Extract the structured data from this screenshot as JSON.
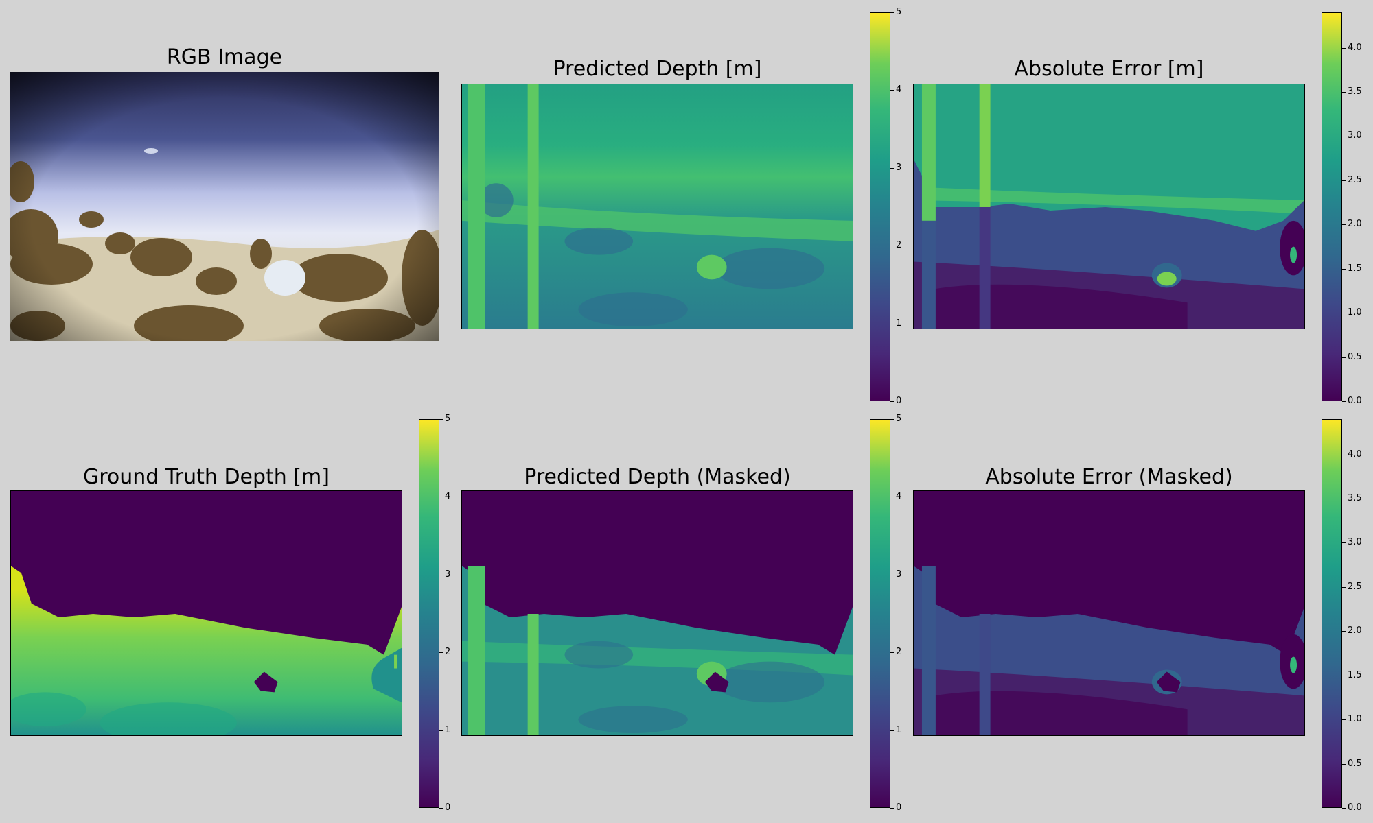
{
  "titles": {
    "rgb": "RGB Image",
    "pred": "Predicted Depth [m]",
    "err": "Absolute Error [m]",
    "gt": "Ground Truth Depth [m]",
    "pred_masked": "Predicted Depth (Masked)",
    "err_masked": "Absolute Error (Masked)"
  },
  "colormap": "viridis",
  "chart_data": [
    {
      "type": "heatmap",
      "title": "RGB Image",
      "content": "underwater photograph of rocks on sandy seabed"
    },
    {
      "type": "heatmap",
      "title": "Predicted Depth [m]",
      "colorbar": {
        "min": 0,
        "max": 5,
        "ticks": [
          "0",
          "1",
          "2",
          "3",
          "4",
          "5"
        ]
      }
    },
    {
      "type": "heatmap",
      "title": "Absolute Error [m]",
      "colorbar": {
        "min": 0,
        "max": 4.4,
        "ticks": [
          "0.0",
          "0.5",
          "1.0",
          "1.5",
          "2.0",
          "2.5",
          "3.0",
          "3.5",
          "4.0"
        ]
      }
    },
    {
      "type": "heatmap",
      "title": "Ground Truth Depth [m]",
      "colorbar": {
        "min": 0,
        "max": 5,
        "ticks": [
          "0",
          "1",
          "2",
          "3",
          "4",
          "5"
        ]
      }
    },
    {
      "type": "heatmap",
      "title": "Predicted Depth (Masked)",
      "colorbar": {
        "min": 0,
        "max": 5,
        "ticks": [
          "0",
          "1",
          "2",
          "3",
          "4",
          "5"
        ]
      }
    },
    {
      "type": "heatmap",
      "title": "Absolute Error (Masked)",
      "colorbar": {
        "min": 0,
        "max": 4.4,
        "ticks": [
          "0.0",
          "0.5",
          "1.0",
          "1.5",
          "2.0",
          "2.5",
          "3.0",
          "3.5",
          "4.0"
        ]
      }
    }
  ]
}
